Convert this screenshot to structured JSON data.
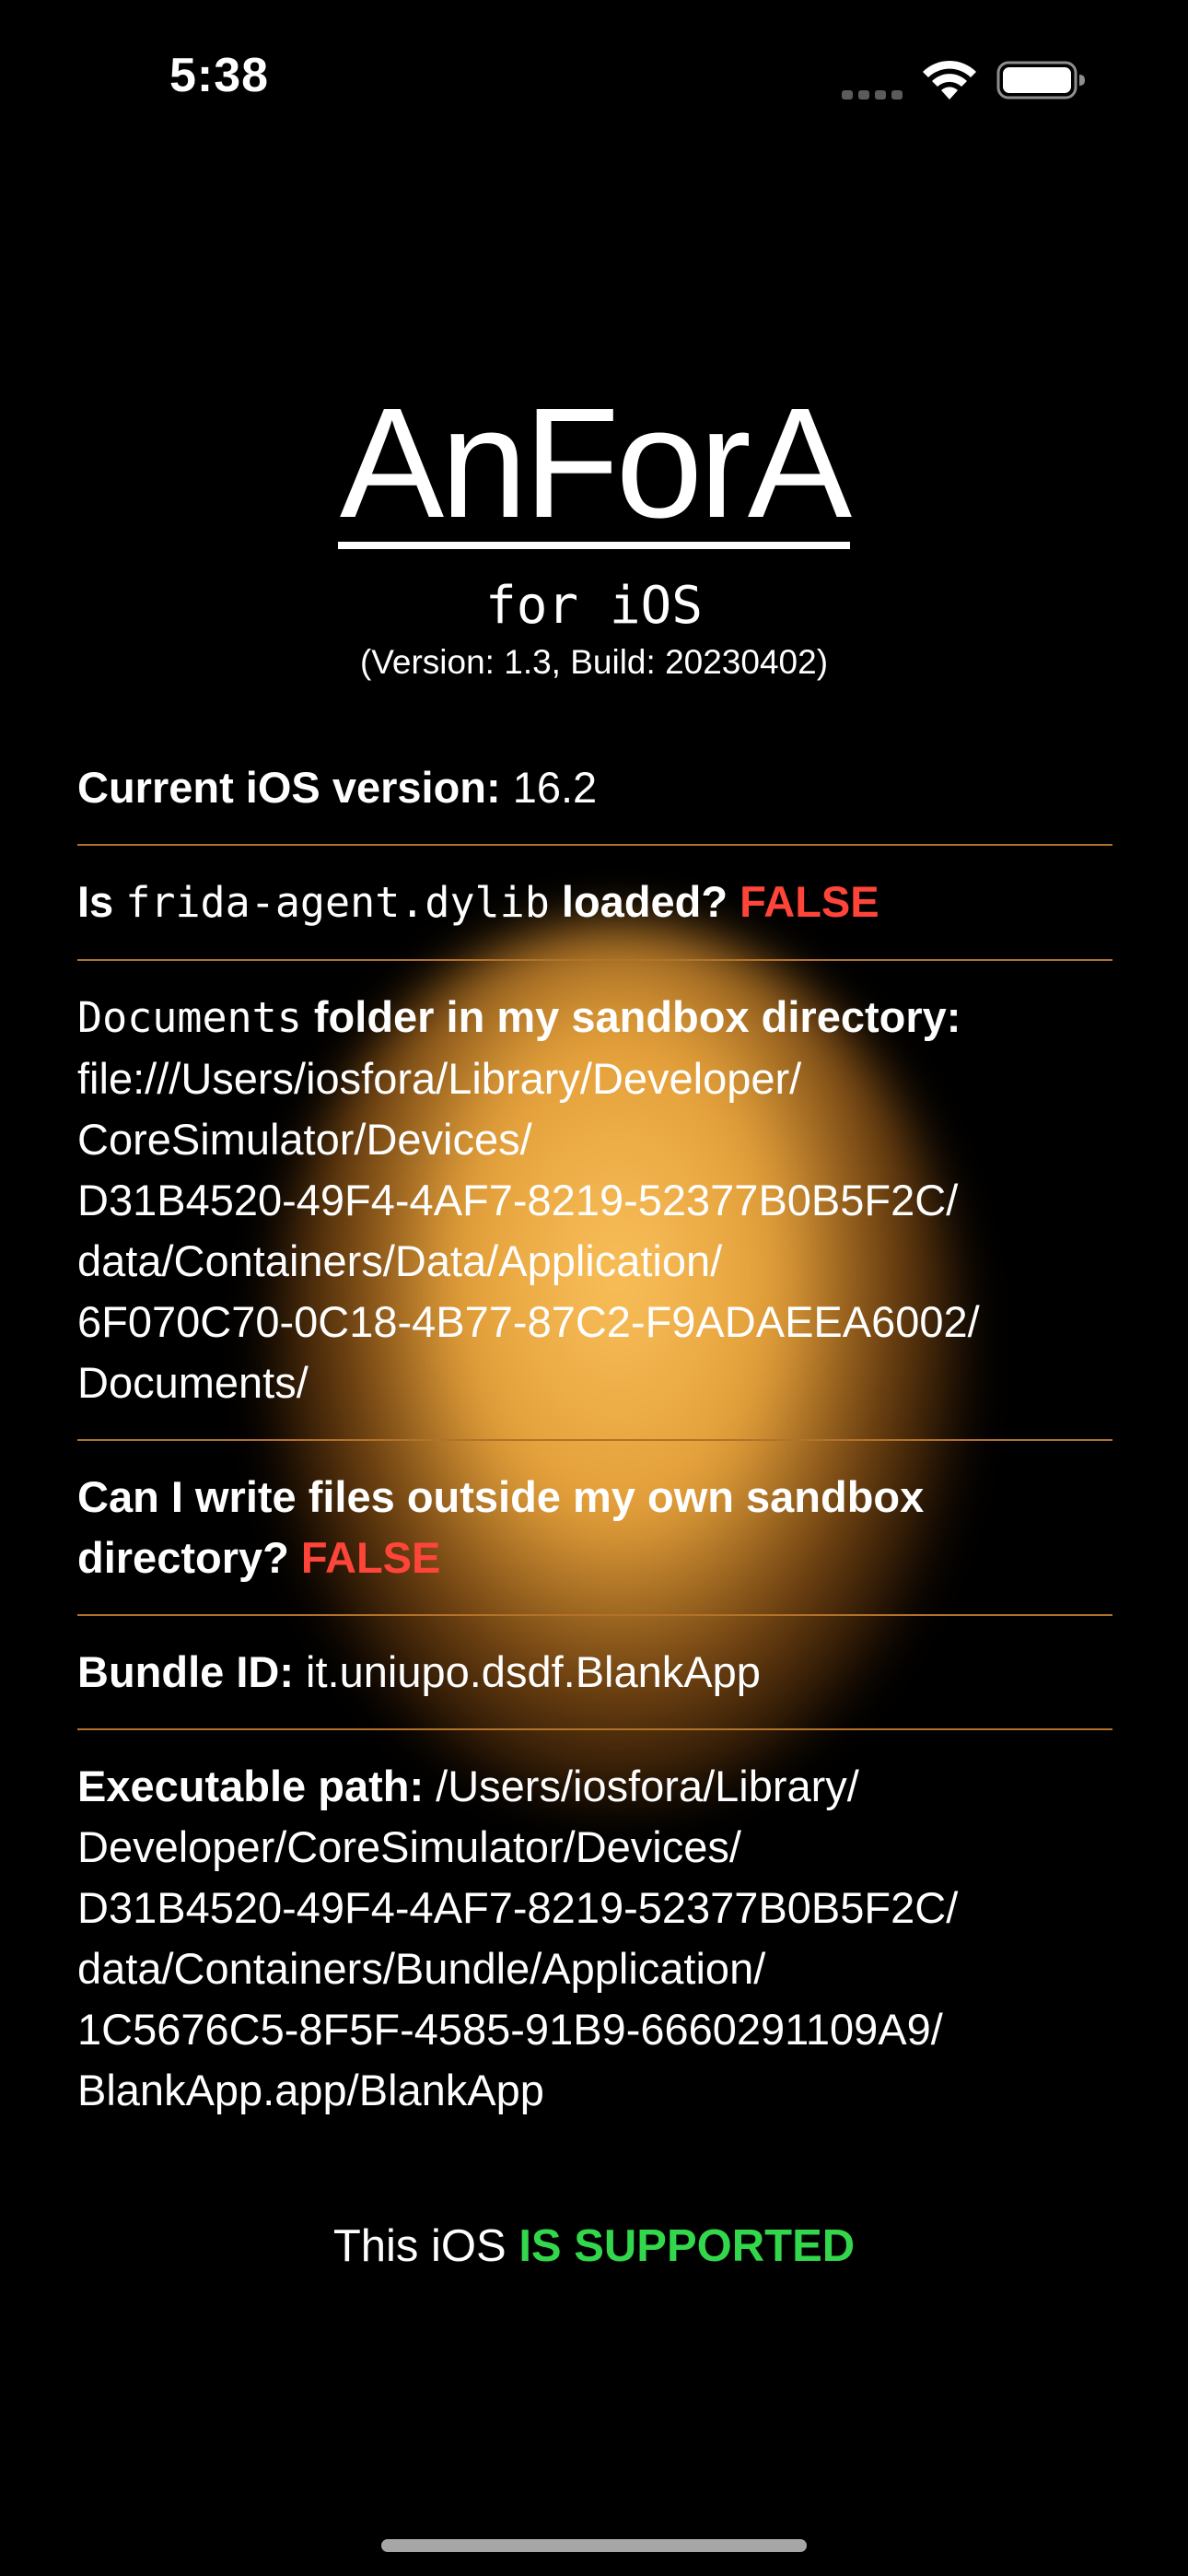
{
  "status_bar": {
    "time": "5:38",
    "icons": [
      "signal-icon",
      "wifi-icon",
      "battery-icon"
    ]
  },
  "header": {
    "title": "AnForA",
    "subtitle": "for iOS",
    "version_line": "(Version: 1.3, Build: 20230402)"
  },
  "info": {
    "ios_version": {
      "label": "Current iOS version:",
      "value": "16.2"
    },
    "frida": {
      "prefix": "Is",
      "code": "frida-agent.dylib",
      "label": "loaded?",
      "value": "FALSE"
    },
    "documents": {
      "code": "Documents",
      "label": "folder in my sandbox directory:",
      "lines": [
        "file:///Users/iosfora/Library/Developer/",
        "CoreSimulator/Devices/",
        "D31B4520-49F4-4AF7-8219-52377B0B5F2C/",
        "data/Containers/Data/Application/",
        "6F070C70-0C18-4B77-87C2-F9ADAEEA6002/",
        "Documents/"
      ]
    },
    "write_outside": {
      "label_line1": "Can I write files outside my own sandbox",
      "label_line2": "directory?",
      "value": "FALSE"
    },
    "bundle_id": {
      "label": "Bundle ID:",
      "value": "it.uniupo.dsdf.BlankApp"
    },
    "executable": {
      "label": "Executable path:",
      "first_line": "/Users/iosfora/Library/",
      "lines": [
        "Developer/CoreSimulator/Devices/",
        "D31B4520-49F4-4AF7-8219-52377B0B5F2C/",
        "data/Containers/Bundle/Application/",
        "1C5676C5-8F5F-4585-91B9-6660291109A9/",
        "BlankApp.app/BlankApp"
      ]
    }
  },
  "support": {
    "prefix": "This iOS",
    "value": "IS SUPPORTED"
  },
  "colors": {
    "background": "#000000",
    "text": "#ffffff",
    "divider": "#b2722a",
    "false": "#ff453a",
    "supported": "#32d74b",
    "glow": "#f6ac3e"
  }
}
